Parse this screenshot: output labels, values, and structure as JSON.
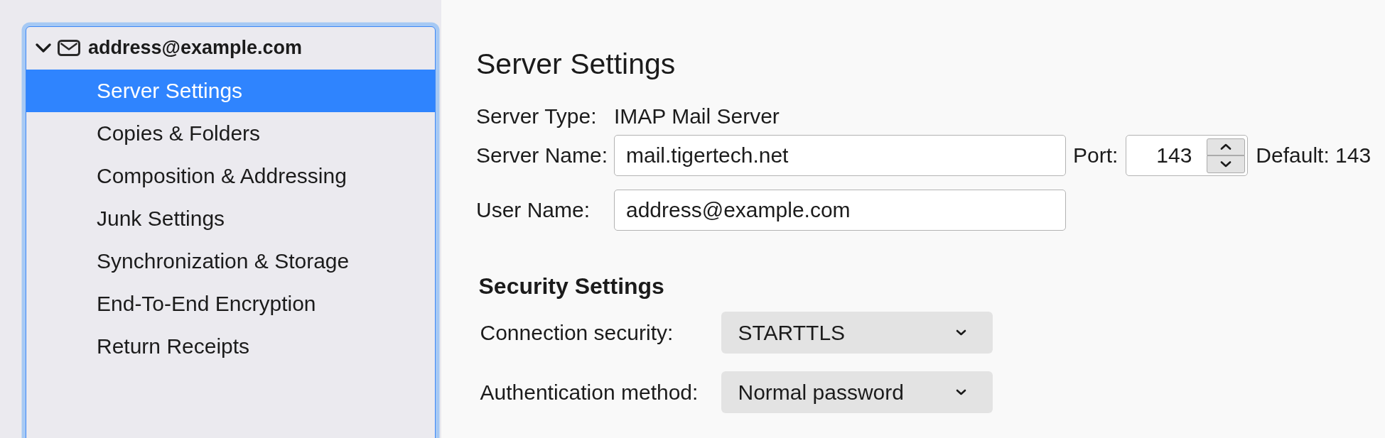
{
  "sidebar": {
    "focused": true,
    "account": {
      "label": "address@example.com",
      "expanded": true
    },
    "items": [
      {
        "label": "Server Settings",
        "selected": true
      },
      {
        "label": "Copies & Folders",
        "selected": false
      },
      {
        "label": "Composition & Addressing",
        "selected": false
      },
      {
        "label": "Junk Settings",
        "selected": false
      },
      {
        "label": "Synchronization & Storage",
        "selected": false
      },
      {
        "label": "End-To-End Encryption",
        "selected": false
      },
      {
        "label": "Return Receipts",
        "selected": false
      }
    ]
  },
  "page": {
    "title": "Server Settings"
  },
  "server": {
    "type_label": "Server Type:",
    "type_value": "IMAP Mail Server",
    "name_label": "Server Name:",
    "name_value": "mail.tigertech.net",
    "port_label": "Port:",
    "port_value": "143",
    "port_default": "Default: 143",
    "user_label": "User Name:",
    "user_value": "address@example.com"
  },
  "security": {
    "title": "Security Settings",
    "fields": [
      {
        "label": "Connection security:",
        "value": "STARTTLS"
      },
      {
        "label": "Authentication method:",
        "value": "Normal password"
      }
    ]
  }
}
